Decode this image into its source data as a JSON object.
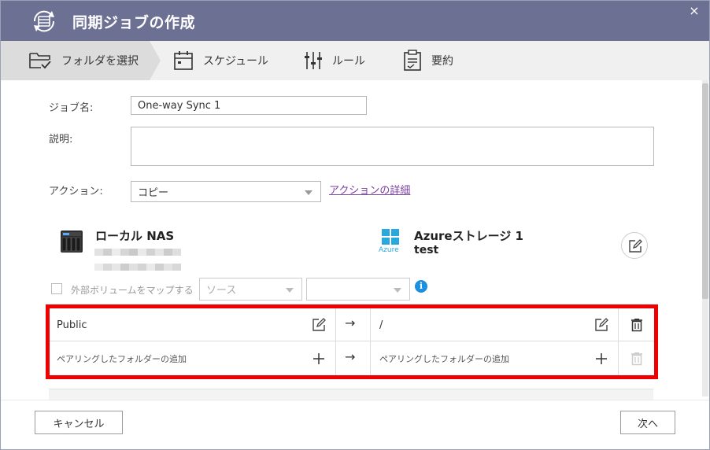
{
  "window": {
    "title": "同期ジョブの作成",
    "close_glyph": "×"
  },
  "steps": [
    {
      "label": "フォルダを選択",
      "icon": "folder-check-icon",
      "active": true
    },
    {
      "label": "スケジュール",
      "icon": "calendar-icon",
      "active": false
    },
    {
      "label": "ルール",
      "icon": "sliders-icon",
      "active": false
    },
    {
      "label": "要約",
      "icon": "clipboard-icon",
      "active": false
    }
  ],
  "form": {
    "job_name_label": "ジョブ名:",
    "job_name_value": "One-way Sync 1",
    "description_label": "説明:",
    "description_value": "",
    "action_label": "アクション:",
    "action_value": "コピー",
    "action_details_link": "アクションの詳細"
  },
  "source": {
    "name": "ローカル NAS",
    "icon": "nas-device-icon"
  },
  "destination": {
    "name": "Azureストレージ 1",
    "account": "test",
    "logo_text": "Azure",
    "icon": "azure-logo-icon"
  },
  "volume_map": {
    "checkbox_label": "外部ボリュームをマップする",
    "source_placeholder": "ソース",
    "target_value": "",
    "info_glyph": "i"
  },
  "pairs": [
    {
      "local": "Public",
      "remote": "/"
    },
    {
      "local": "ペアリングしたフォルダーの追加",
      "remote": "ペアリングしたフォルダーの追加"
    }
  ],
  "arrow_glyph": "→",
  "footer": {
    "cancel_label": "キャンセル",
    "next_label": "次へ"
  },
  "colors": {
    "titlebar": "#6c7193",
    "highlight": "#ee0000",
    "link": "#7b3fa0",
    "info": "#1b8fe0"
  }
}
